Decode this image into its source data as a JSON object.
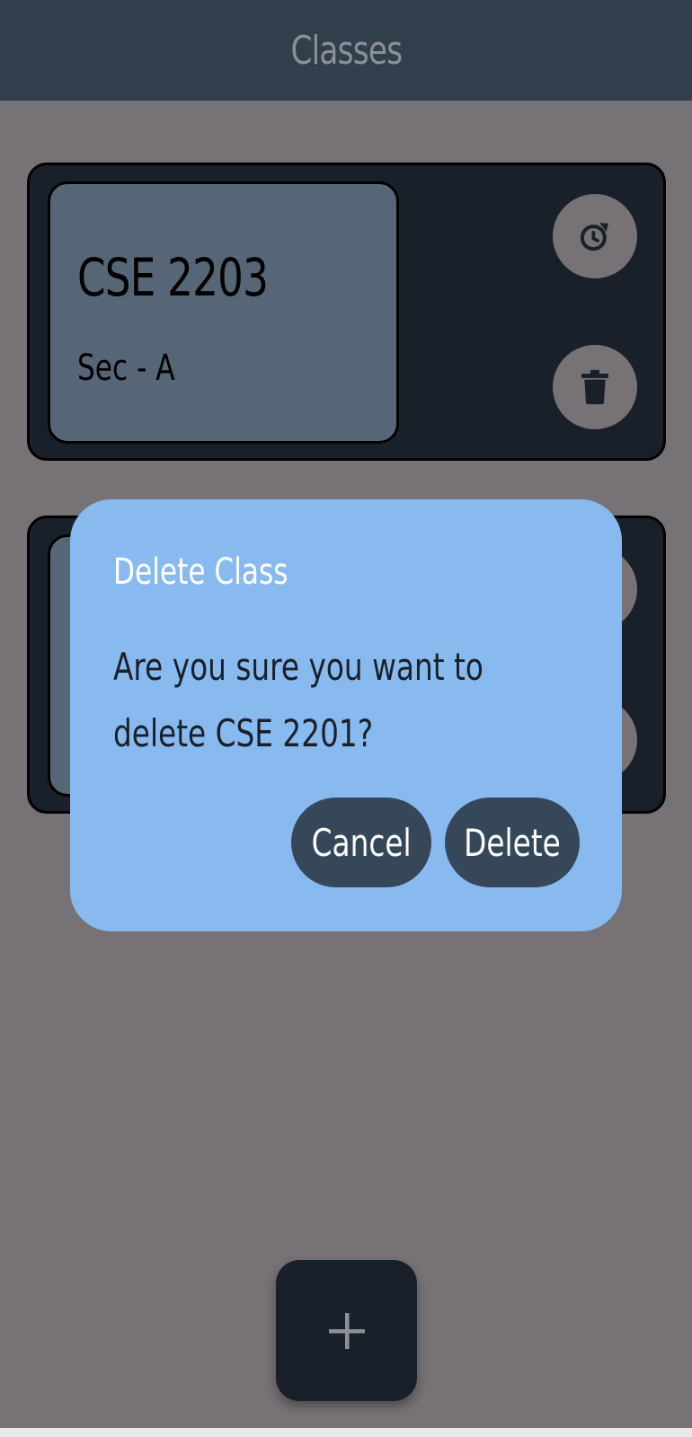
{
  "app_bar": {
    "title": "Classes"
  },
  "classes": [
    {
      "code": "CSE 2203",
      "section": "Sec - A",
      "reschedule_icon": "history-clock-icon",
      "delete_icon": "trash-icon"
    },
    {
      "code": "",
      "section": "",
      "reschedule_icon": "history-clock-icon",
      "delete_icon": "trash-icon"
    }
  ],
  "dialog": {
    "title": "Delete Class",
    "message": "Are you sure you want to delete CSE 2201?",
    "cancel_label": "Cancel",
    "delete_label": "Delete"
  },
  "fab": {
    "icon": "plus-icon"
  },
  "colors": {
    "app_bar": "#313e4c",
    "background": "#777276",
    "card": "#1a2029",
    "card_inner": "#576677",
    "dialog": "#88baf0",
    "dialog_button": "#354759"
  }
}
